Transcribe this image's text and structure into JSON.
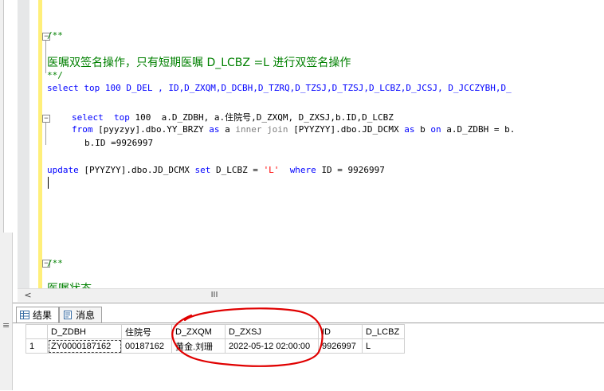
{
  "editor": {
    "lines": {
      "c1_open": "/**",
      "c1_text": "医嘱双签名操作，只有短期医嘱 D_LCBZ =L 进行双签名操作",
      "c1_close": "**/",
      "sel1": "select top 100 D_DEL , ID,D_ZXQM,D_DCBH,D_TZRQ,D_TZSJ,D_TZSJ,D_LCBZ,D_JCSJ, D_JCCZYBH,D_",
      "sel2_kw1": "select",
      "sel2_kw2": "top",
      "sel2_rest": " 100  a.D_ZDBH, a.住院号,D_ZXQM, D_ZXSJ,b.ID,D_LCBZ",
      "from_kw": "from",
      "from_tbl1": "[pyyzyy].dbo.YY_BRZY",
      "as1": "as",
      "a_alias": "a",
      "inner_kw": "inner join",
      "from_tbl2": "[PYYZYY].dbo.JD_DCMX",
      "as2": "as",
      "b_alias": "b",
      "on_kw": "on",
      "on_rest": "a.D_ZDBH = b.",
      "where_cont": "b.ID =9926997",
      "upd_kw": "update",
      "upd_tbl": "[PYYZYY].dbo.JD_DCMX",
      "set_kw": "set",
      "set_col": "D_LCBZ = ",
      "set_val": "'L'",
      "where_kw": "where",
      "where_rest": "ID = 9926997",
      "c2_open": "/**",
      "c2_partial": "医嘱状态"
    }
  },
  "scrollbar": {
    "left_arrow": "<",
    "grip": "III"
  },
  "results": {
    "tabs": [
      {
        "label": "结果"
      },
      {
        "label": "消息"
      }
    ],
    "columns": [
      "D_ZDBH",
      "住院号",
      "D_ZXQM",
      "D_ZXSJ",
      "ID",
      "D_LCBZ"
    ],
    "rows": [
      {
        "num": "1",
        "D_ZDBH": "ZY0000187162",
        "zyh": "00187162",
        "D_ZXQM": "黄金.刘珊",
        "D_ZXSJ": "2022-05-12 02:00:00",
        "ID": "9926997",
        "D_LCBZ": "L"
      }
    ]
  },
  "colors": {
    "keyword": "#0000ff",
    "comment": "#008000",
    "string": "#ff0000",
    "annotation": "#e00000",
    "change_bar": "#ffef7a"
  }
}
